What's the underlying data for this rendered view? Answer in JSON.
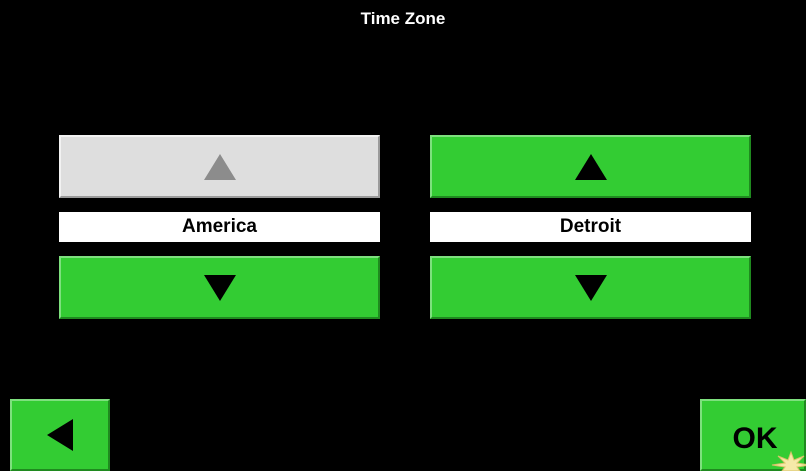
{
  "screen": {
    "title": "Time Zone"
  },
  "region": {
    "value": "America",
    "up_enabled": false,
    "down_enabled": true
  },
  "city": {
    "value": "Detroit",
    "up_enabled": true,
    "down_enabled": true
  },
  "footer": {
    "ok_label": "OK"
  },
  "icons": {
    "region_up": "triangle-up-icon",
    "region_down": "triangle-down-icon",
    "city_up": "triangle-up-icon",
    "city_down": "triangle-down-icon",
    "back": "triangle-left-icon"
  },
  "colors": {
    "background": "#000000",
    "button_green": "#33cc33",
    "button_disabled": "#dedede",
    "value_box": "#ffffff"
  }
}
